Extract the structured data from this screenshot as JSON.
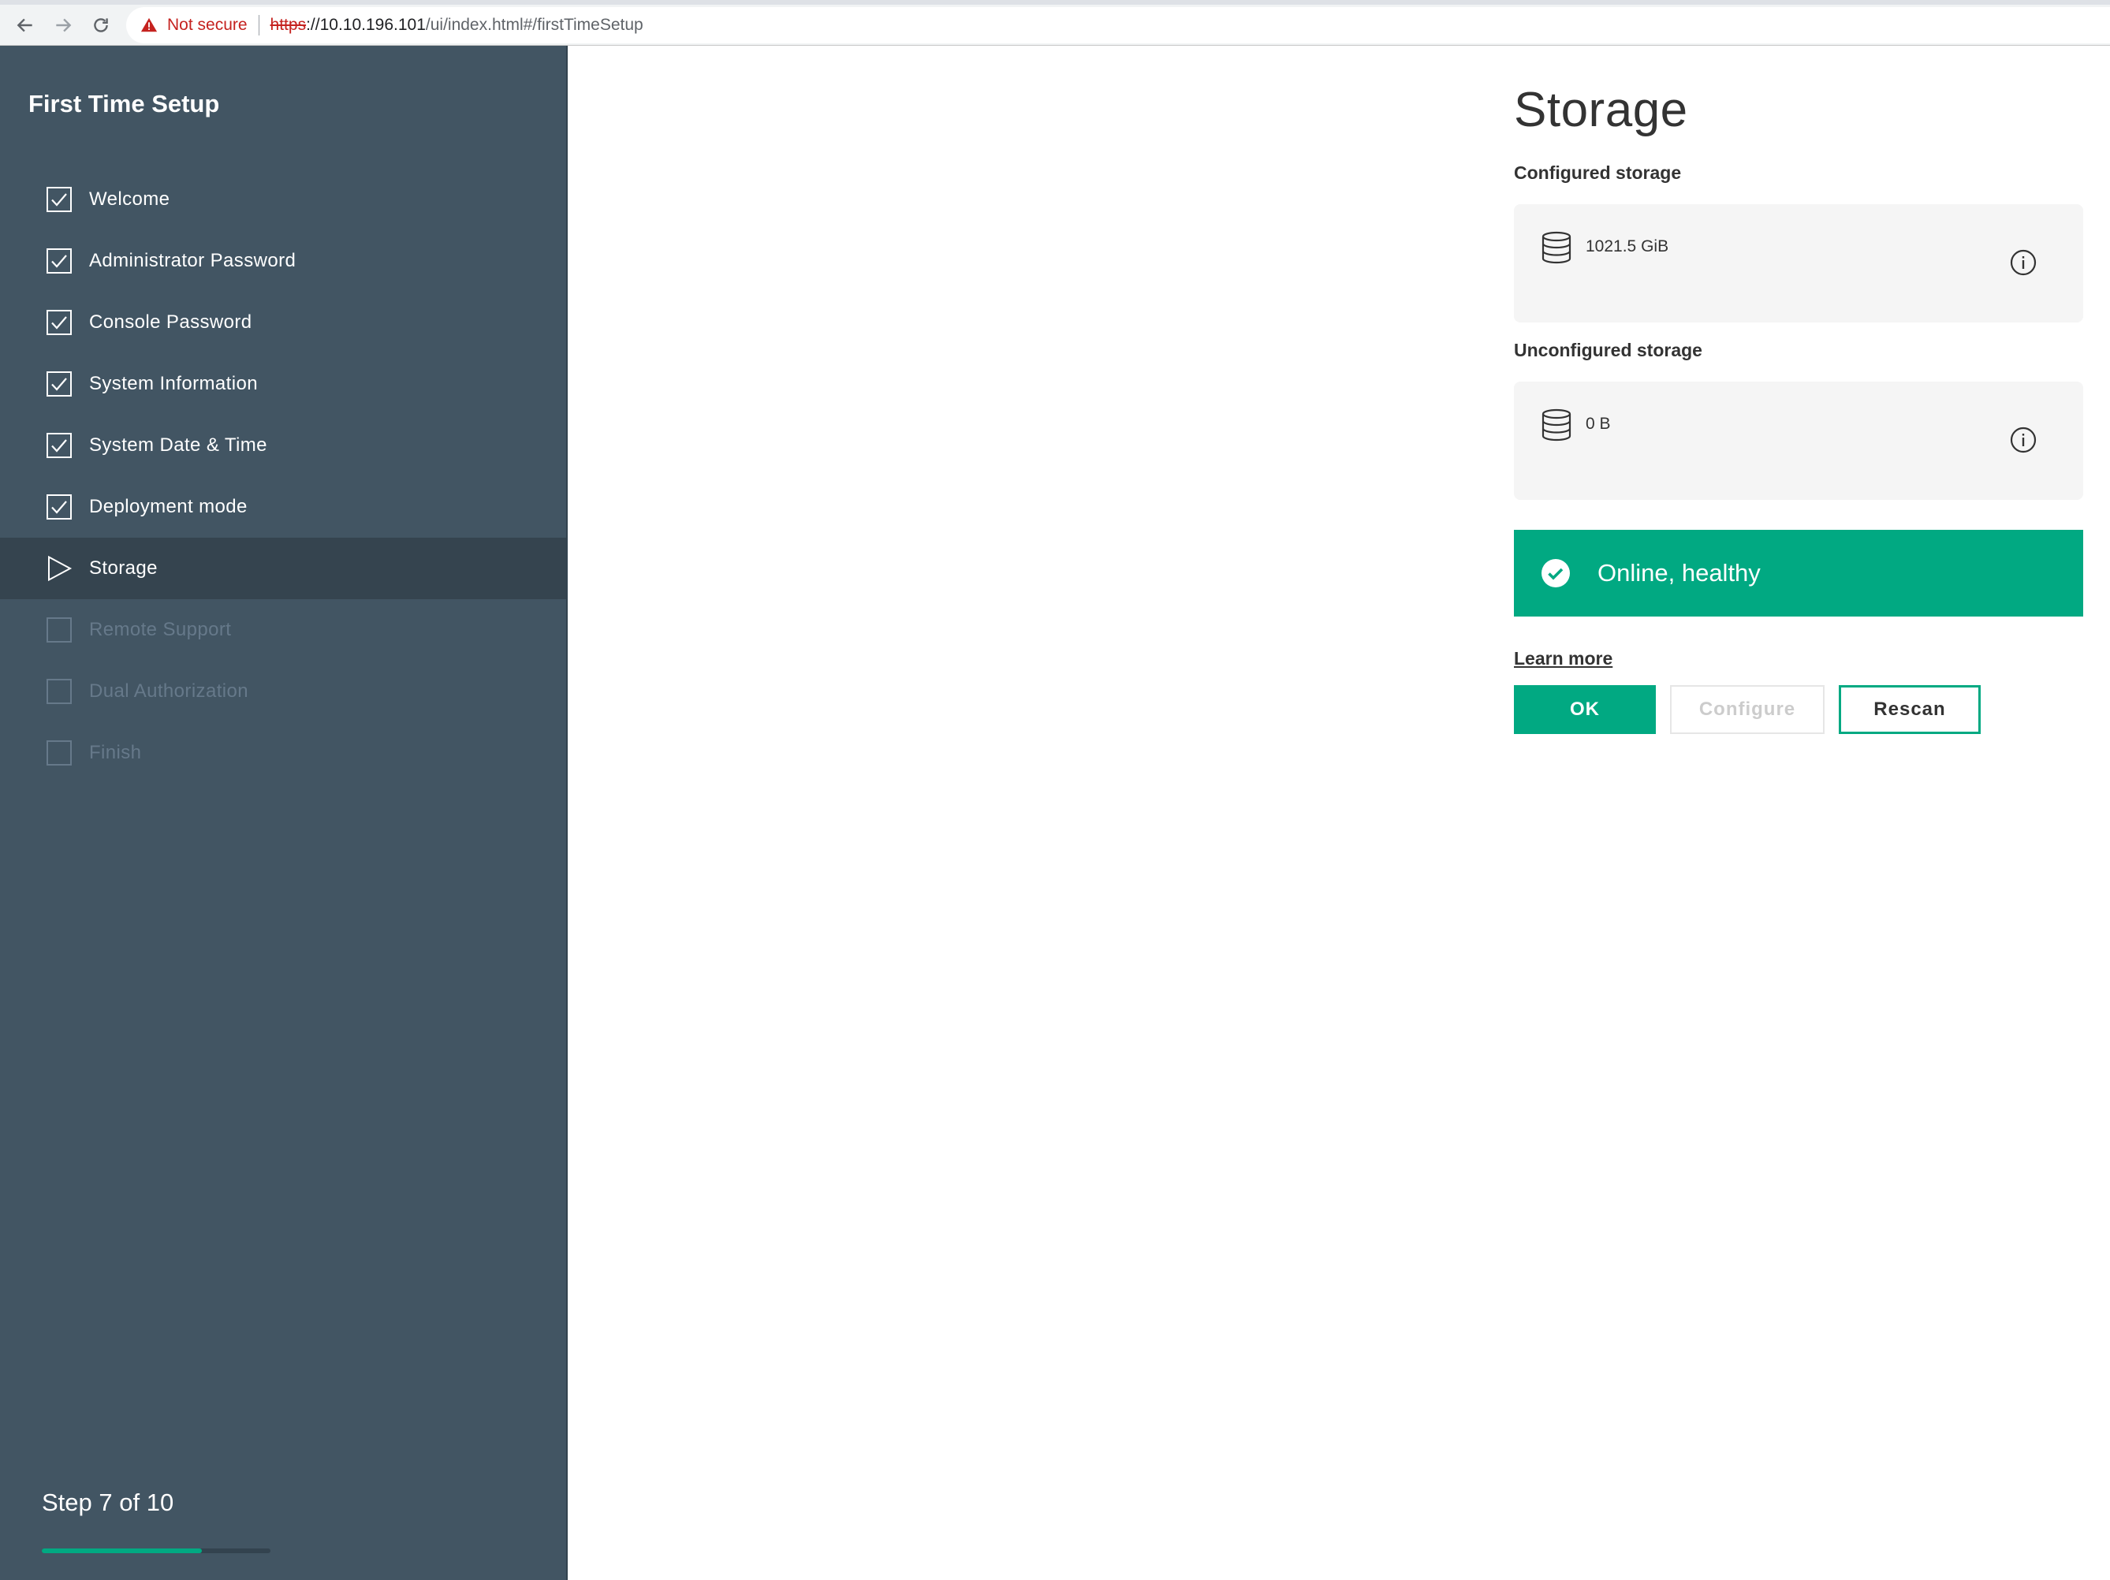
{
  "browser": {
    "security_label": "Not secure",
    "url_protocol": "https",
    "url_host": "://10.10.196.101",
    "url_path": "/ui/index.html#/firstTimeSetup"
  },
  "sidebar": {
    "title": "First Time Setup",
    "steps": [
      {
        "label": "Welcome",
        "state": "complete"
      },
      {
        "label": "Administrator Password",
        "state": "complete"
      },
      {
        "label": "Console Password",
        "state": "complete"
      },
      {
        "label": "System Information",
        "state": "complete"
      },
      {
        "label": "System Date & Time",
        "state": "complete"
      },
      {
        "label": "Deployment mode",
        "state": "complete"
      },
      {
        "label": "Storage",
        "state": "active"
      },
      {
        "label": "Remote Support",
        "state": "pending"
      },
      {
        "label": "Dual Authorization",
        "state": "pending"
      },
      {
        "label": "Finish",
        "state": "pending"
      }
    ],
    "step_counter": "Step 7 of 10",
    "progress_fraction": 0.7
  },
  "main": {
    "title": "Storage",
    "configured_label": "Configured storage",
    "configured_value": "1021.5 GiB",
    "unconfigured_label": "Unconfigured storage",
    "unconfigured_value": "0 B",
    "status_text": "Online, healthy",
    "learn_more": "Learn more",
    "buttons": {
      "ok": "OK",
      "configure": "Configure",
      "rescan": "Rescan"
    }
  },
  "colors": {
    "sidebar_bg": "#425563",
    "accent": "#01a982",
    "pending_text": "#66798a"
  },
  "icons": {
    "back": "arrow-left-icon",
    "forward": "arrow-right-icon",
    "reload": "reload-icon",
    "warning": "warning-triangle-icon",
    "step_complete": "checkbox-checked-icon",
    "step_active": "play-triangle-icon",
    "step_pending": "checkbox-empty-icon",
    "storage": "database-icon",
    "info": "info-circle-icon",
    "status": "check-circle-icon"
  }
}
